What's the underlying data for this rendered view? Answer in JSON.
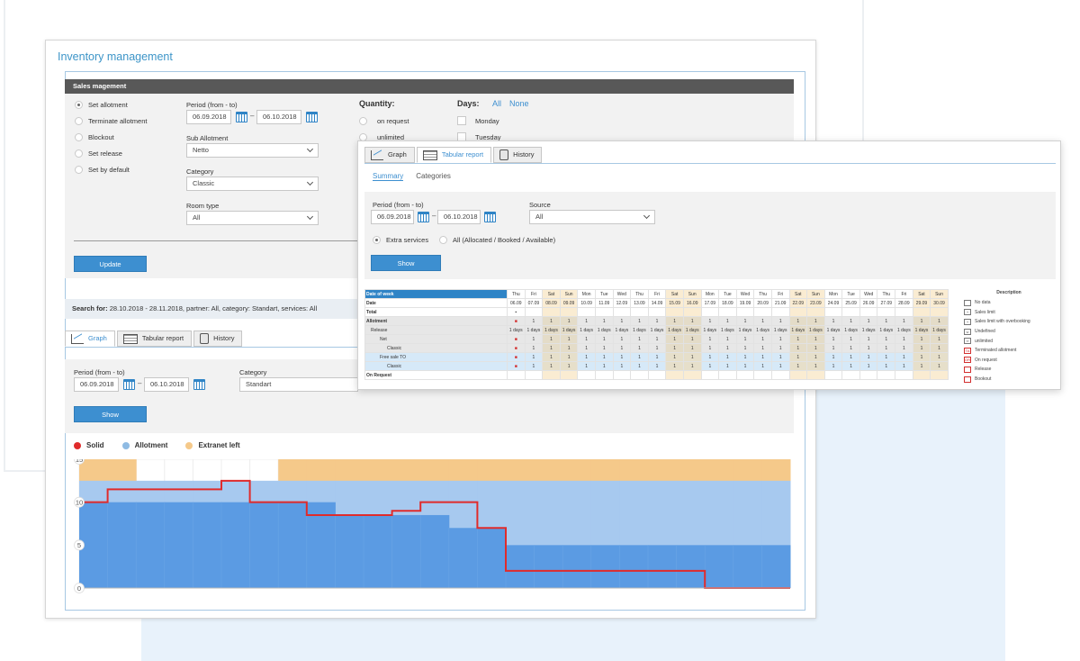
{
  "main": {
    "title": "Inventory management",
    "sales_header": "Sales magement",
    "radios": [
      "Set allotment",
      "Terminate allotment",
      "Blockout",
      "Set release",
      "Set by default"
    ],
    "selected_radio": 0,
    "period_label": "Period (from - to)",
    "period_from": "06.09.2018",
    "period_to": "06.10.2018",
    "sub_allotment_label": "Sub Allotment",
    "sub_allotment_value": "Netto",
    "category_label": "Category",
    "category_value": "Classic",
    "room_type_label": "Room type",
    "room_type_value": "All",
    "quantity_label": "Quantity:",
    "quantity_options": [
      "on request",
      "unlimited"
    ],
    "days_label": "Days:",
    "days_all": "All",
    "days_none": "None",
    "days": [
      "Monday",
      "Tuesday"
    ],
    "update_button": "Update",
    "search_prefix": "Search for:",
    "search_text": "28.10.2018 - 28.11.2018,  partner: All,  category: Standart,  services: All",
    "tabs": [
      "Graph",
      "Tabular report",
      "History"
    ],
    "graph_period_label": "Period (from - to)",
    "graph_period_from": "06.09.2018",
    "graph_period_to": "06.10.2018",
    "graph_category_label": "Category",
    "graph_category_value": "Standart",
    "show_button": "Show",
    "legend": [
      {
        "name": "Solid",
        "color": "#e02b2b"
      },
      {
        "name": "Allotment",
        "color": "#8fbbe3"
      },
      {
        "name": "Extranet left",
        "color": "#f5c98a"
      }
    ]
  },
  "chart_data": {
    "type": "area",
    "yticks": [
      0,
      5,
      10,
      15
    ],
    "ylim": [
      0,
      15
    ],
    "x": [
      0,
      1,
      2,
      3,
      4,
      5,
      6,
      7,
      8,
      9,
      10,
      11,
      12,
      13,
      14,
      15,
      16,
      17,
      18,
      19,
      20,
      21,
      22,
      23,
      24
    ],
    "series": [
      {
        "name": "Extranet left",
        "color": "#f5c98a",
        "values": [
          15,
          15,
          12.5,
          12.5,
          12.5,
          12.5,
          12.5,
          15,
          15,
          15,
          15,
          15,
          15,
          15,
          15,
          15,
          15,
          15,
          15,
          15,
          15,
          15,
          15,
          15,
          15
        ]
      },
      {
        "name": "Allotment",
        "color": "#a7c9ef",
        "values": [
          12.5,
          12.5,
          12.5,
          12.5,
          12.5,
          12.5,
          12.5,
          12.5,
          12.5,
          12.5,
          12.5,
          12.5,
          12.5,
          12.5,
          12.5,
          12.5,
          12.5,
          12.5,
          12.5,
          12.5,
          12.5,
          12.5,
          12.5,
          12.5,
          12.5
        ]
      },
      {
        "name": "",
        "color": "#5b9be3",
        "values": [
          10,
          10,
          10,
          10,
          10,
          10,
          10,
          10,
          10,
          8.5,
          8.5,
          8.5,
          8.5,
          7,
          7,
          5,
          5,
          5,
          5,
          5,
          5,
          5,
          5,
          5,
          5
        ]
      },
      {
        "name": "Solid",
        "color": "#e02b2b",
        "values": [
          10,
          11.5,
          11.5,
          11.5,
          11.5,
          12.5,
          10,
          10,
          8.5,
          8.5,
          8.5,
          9,
          10,
          10,
          7,
          2,
          2,
          2,
          2,
          2,
          2,
          2,
          0,
          0,
          0
        ]
      }
    ]
  },
  "overlay": {
    "tabs": [
      "Graph",
      "Tabular report",
      "History"
    ],
    "active_tab": 1,
    "subtabs": [
      "Summary",
      "Categories"
    ],
    "period_label": "Period (from - to)",
    "period_from": "06.09.2018",
    "period_to": "06.10.2018",
    "source_label": "Source",
    "source_value": "All",
    "radio_1": "Extra services",
    "radio_2": "All (Allocated / Booked / Available)",
    "show_button": "Show",
    "table": {
      "row_labels": [
        "Date of week",
        "Date",
        "Total",
        "Allotment",
        "Release",
        "Net",
        "Classic",
        "Free sale TO",
        "Classic",
        "On Request"
      ],
      "weekdays": [
        "Thu",
        "Fri",
        "Sat",
        "Sun",
        "Mon",
        "Tue",
        "Wed",
        "Thu",
        "Fri",
        "Sat",
        "Sun",
        "Mon",
        "Tue",
        "Wed",
        "Thu",
        "Fri",
        "Sat",
        "Sun",
        "Mon",
        "Tue",
        "Wed",
        "Thu",
        "Fri",
        "Sat",
        "Sun"
      ],
      "dates": [
        "06.09",
        "07.09",
        "08.09",
        "09.09",
        "10.09",
        "11.09",
        "12.09",
        "13.09",
        "14.09",
        "15.09",
        "16.09",
        "17.09",
        "18.09",
        "19.09",
        "20.09",
        "21.09",
        "22.09",
        "23.09",
        "24.09",
        "25.09",
        "26.09",
        "27.09",
        "28.09",
        "29.09",
        "30.09"
      ],
      "cell_value": "1",
      "release_value": "1 days"
    },
    "description": {
      "title": "Description",
      "items": [
        "No data",
        "Sales limit",
        "Sales limit with overbooking",
        "Undefined",
        "unlimited",
        "Terminated allotment",
        "On request",
        "Release",
        "Bookout"
      ]
    }
  }
}
